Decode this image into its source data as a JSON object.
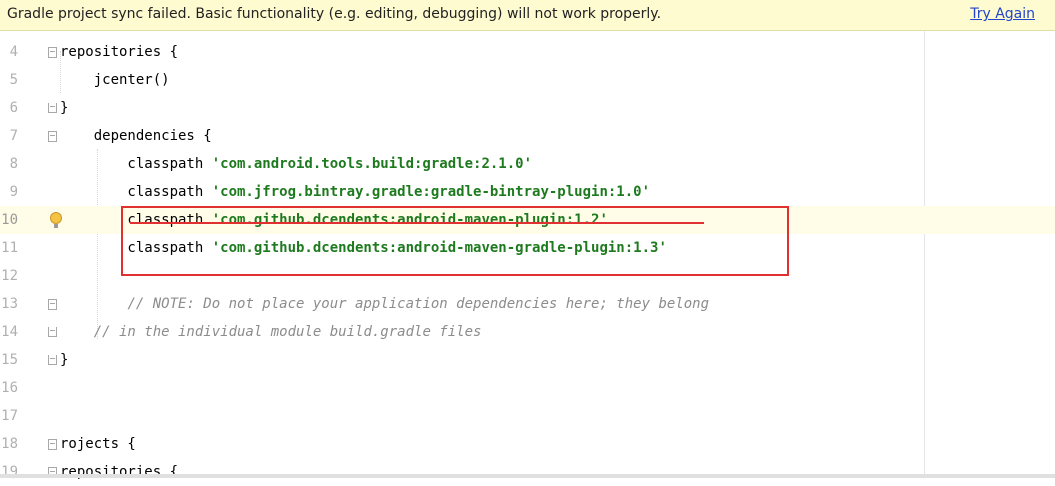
{
  "banner": {
    "message": "Gradle project sync failed. Basic functionality (e.g. editing, debugging) will not work properly.",
    "action_label": "Try Again"
  },
  "editor": {
    "lines": [
      {
        "num": "4",
        "pre": "repositories {",
        "str": "",
        "cmt": ""
      },
      {
        "num": "5",
        "pre": "    jcenter()",
        "str": "",
        "cmt": ""
      },
      {
        "num": "6",
        "pre": "}",
        "str": "",
        "cmt": ""
      },
      {
        "num": "7",
        "pre": "    dependencies {",
        "str": "",
        "cmt": ""
      },
      {
        "num": "8",
        "pre": "        classpath ",
        "str": "'com.android.tools.build:gradle:2.1.0'",
        "cmt": ""
      },
      {
        "num": "9",
        "pre": "        classpath ",
        "str": "'com.jfrog.bintray.gradle:gradle-bintray-plugin:1.0'",
        "cmt": ""
      },
      {
        "num": "10",
        "pre": "        classpath ",
        "str": "'com.github.dcendents:android-maven-plugin:1.2'",
        "cmt": ""
      },
      {
        "num": "11",
        "pre": "        classpath ",
        "str": "'com.github.dcendents:android-maven-gradle-plugin:1.3'",
        "cmt": ""
      },
      {
        "num": "12",
        "pre": "",
        "str": "",
        "cmt": ""
      },
      {
        "num": "13",
        "pre": "        ",
        "str": "",
        "cmt": "// NOTE: Do not place your application dependencies here; they belong"
      },
      {
        "num": "14",
        "pre": "    ",
        "str": "",
        "cmt": "// in the individual module build.gradle files"
      },
      {
        "num": "15",
        "pre": "}",
        "str": "",
        "cmt": ""
      },
      {
        "num": "16",
        "pre": "",
        "str": "",
        "cmt": ""
      },
      {
        "num": "17",
        "pre": "",
        "str": "",
        "cmt": ""
      },
      {
        "num": "18",
        "pre": "rojects {",
        "str": "",
        "cmt": ""
      },
      {
        "num": "19",
        "pre": "repositories {",
        "str": "",
        "cmt": ""
      }
    ]
  },
  "colors": {
    "banner_bg": "#fffbd1",
    "link": "#2244cc",
    "string": "#1e7a1e",
    "comment": "#8c8c8c",
    "line_number": "#b0b0b0",
    "annotation": "#e03030",
    "current_line": "#fffce8"
  },
  "icons": [
    "lightbulb-icon",
    "fold-marker-icon"
  ]
}
